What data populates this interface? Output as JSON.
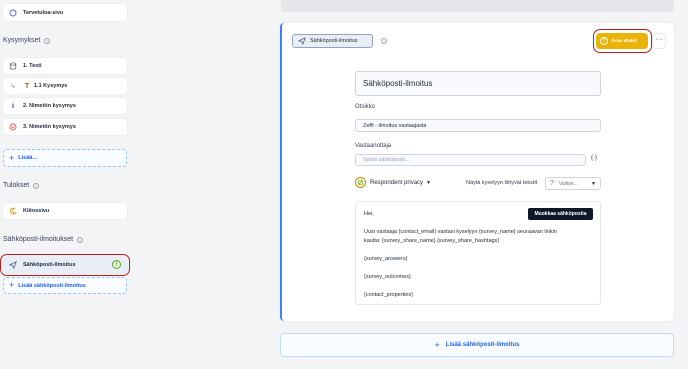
{
  "sidebar": {
    "thanks_top_label": "Tervetuloa-sivu",
    "questions_title": "Kysymykset",
    "questions": [
      {
        "label": "1. Testi"
      },
      {
        "label": "1.1 Kysymys"
      },
      {
        "label": "2. Nimetön kysymys"
      },
      {
        "label": "3. Nimetön kysymys"
      }
    ],
    "add_label": "Lisää...",
    "results_title": "Tulokset",
    "results_item": "Kiitossivu",
    "email_title": "Sähköposti-ilmoitukset",
    "email_item": "Sähköposti-ilmoitus",
    "add_email_label": "Lisää sähköposti-ilmoitus"
  },
  "panel": {
    "tag_label": "Sähköposti-ilmoitus",
    "activate_label": "Avaa ehdot",
    "more_label": "···",
    "name_value": "Sähköposti-ilmoitus",
    "subject_label": "Otsikko",
    "subject_value": "Zeffi - ilmoitus vastaajasta",
    "recipient_label": "Vastaanottaja",
    "recipient_placeholder": "Syötä sähköposti...",
    "privacy_label": "Respondent privacy",
    "show_answers_label": "Näytä kyselyyn liittyvät tekstit",
    "select_placeholder": "Valitse...",
    "edit_email_button": "Muokkaa sähköpostia",
    "body": {
      "greeting": "Hei,",
      "line1": "Uusi vastaaja {contact_email} vastasi kyselyyn {survey_name} seuraavan linkin",
      "line2": "kautta: {survey_share_name} {survey_share_hashtags}",
      "answers": "{survey_answers}",
      "outcomes": "{survey_outcomes}",
      "properties": "{contact_properties}"
    }
  },
  "add_email_big_label": "Lisää sähköposti-ilmoitus",
  "colors": {
    "accent": "#3b82f6",
    "warning": "#eab308",
    "highlight_ring": "#b91c1c"
  }
}
